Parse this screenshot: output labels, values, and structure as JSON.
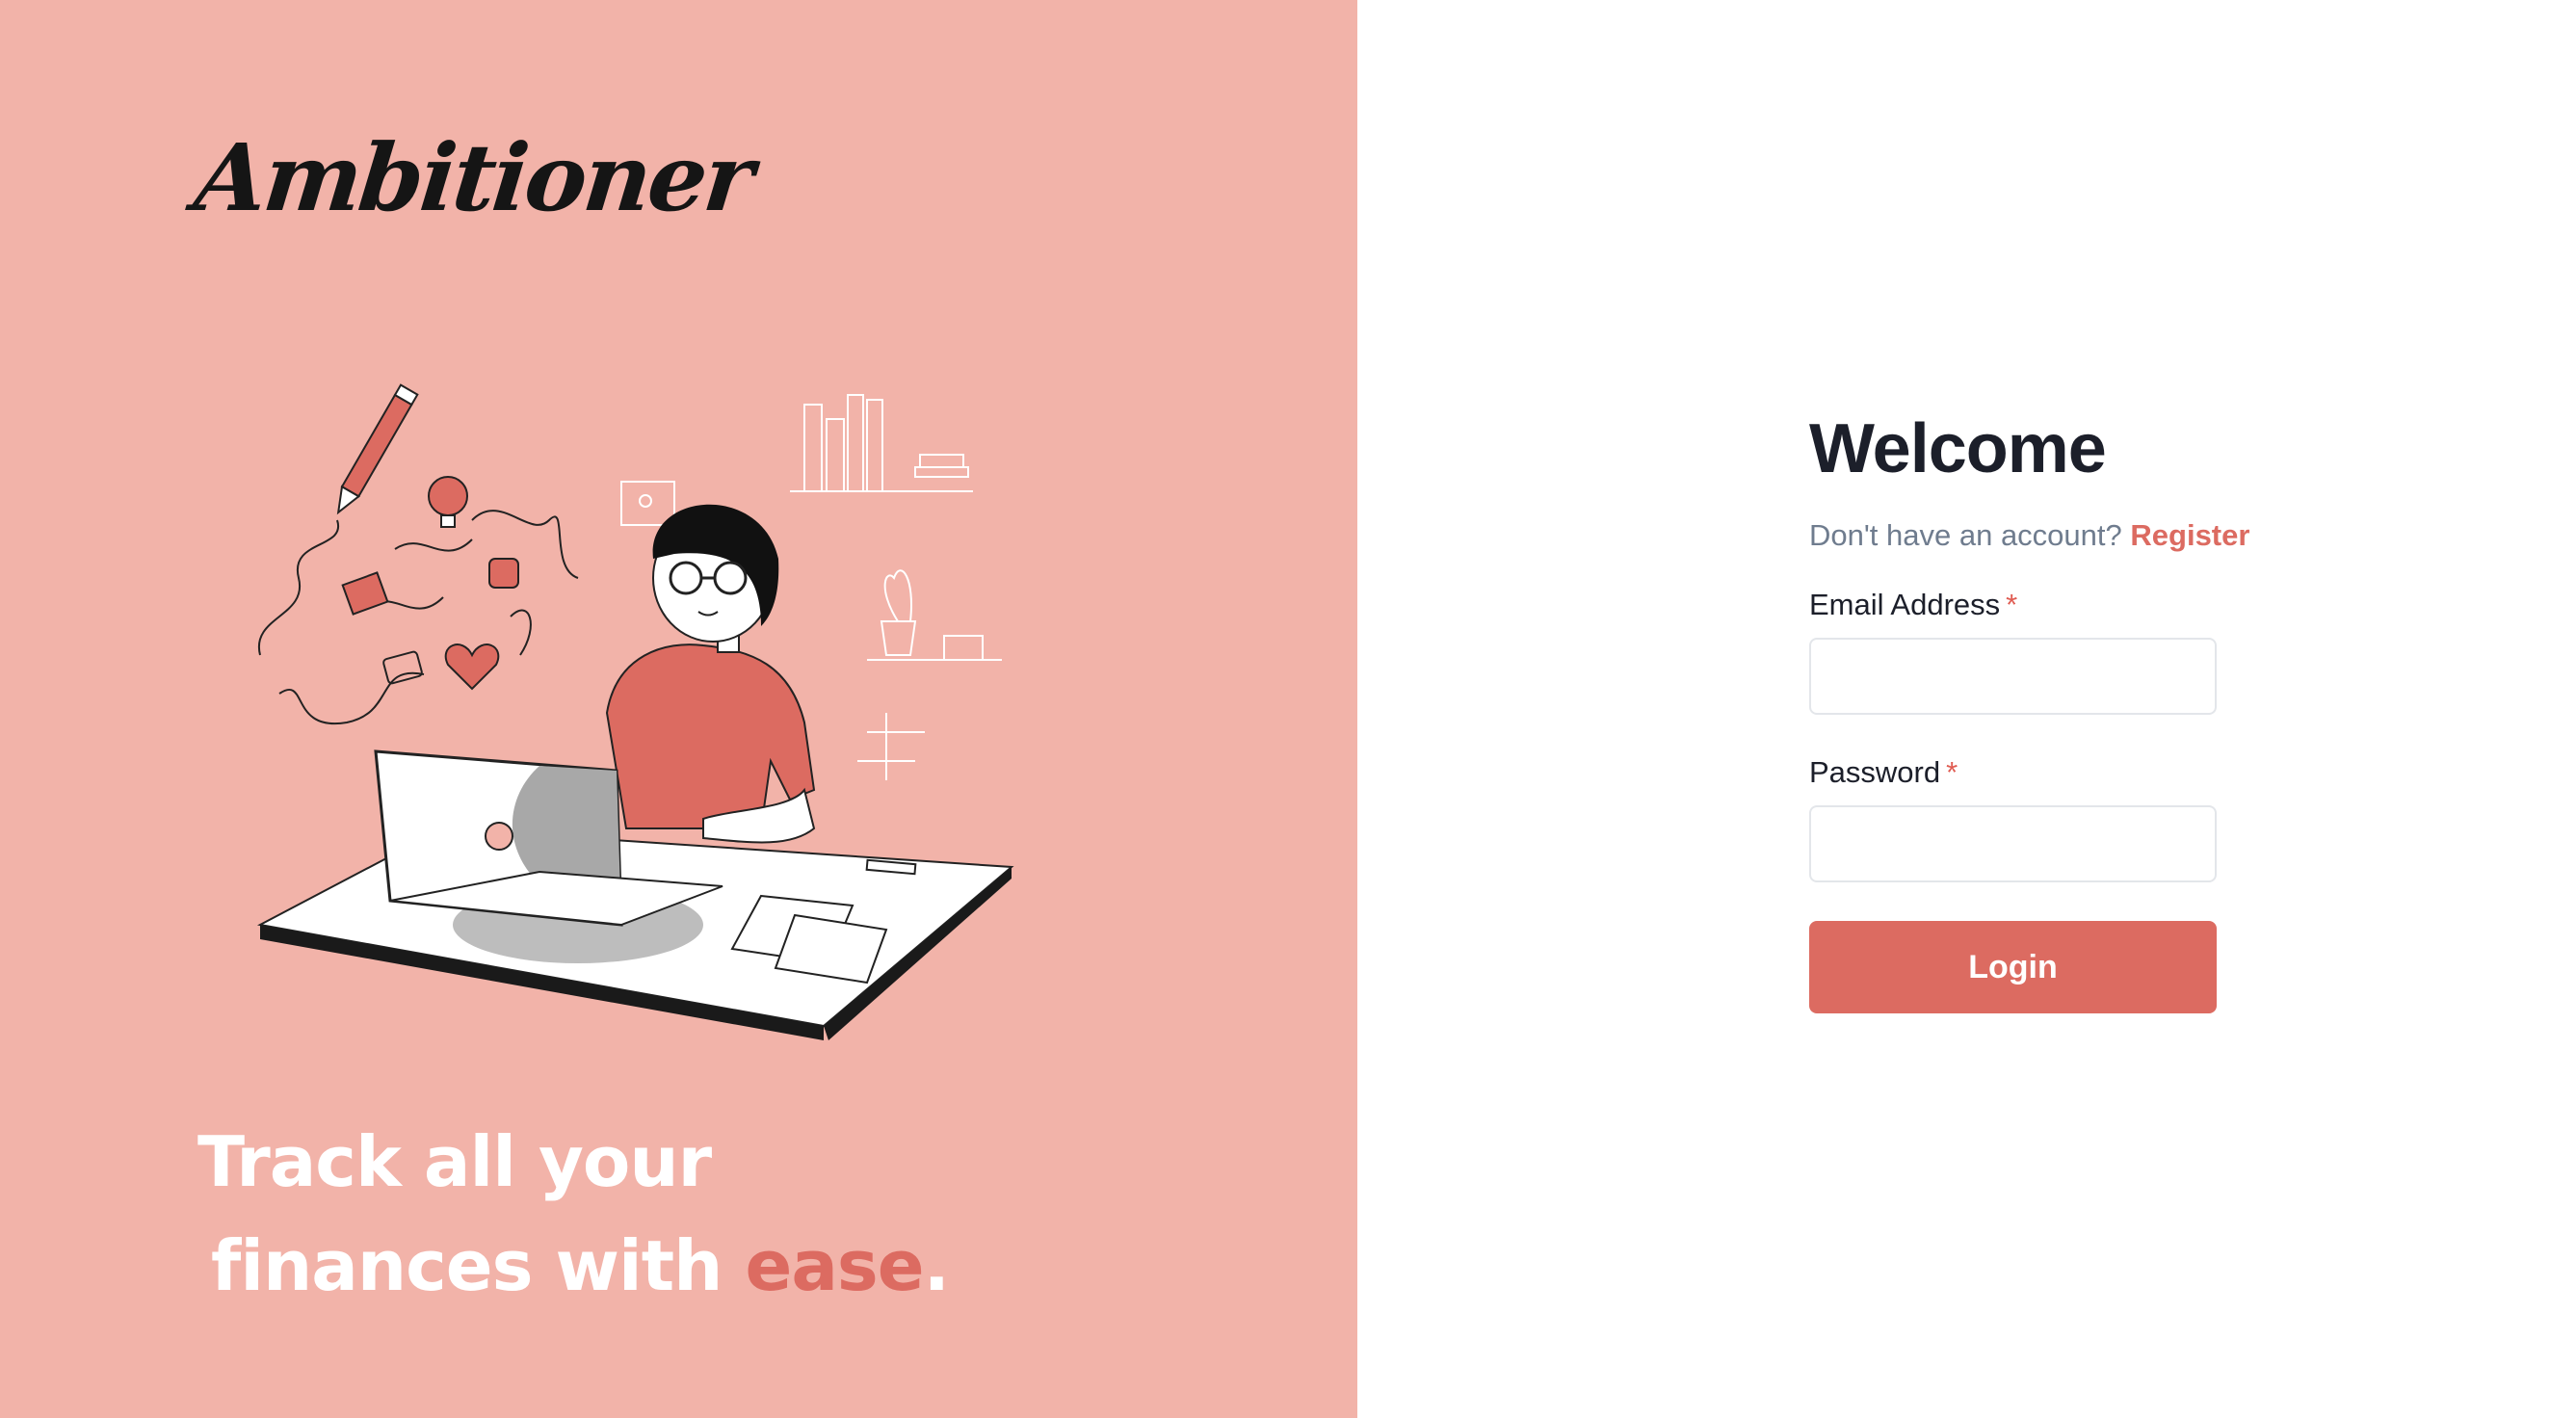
{
  "brand": {
    "logo_text": "Ambitioner"
  },
  "hero": {
    "tagline_line1": "Track all your",
    "tagline_line2_prefix": "finances with ",
    "tagline_accent": "ease",
    "tagline_suffix": "."
  },
  "login": {
    "title": "Welcome",
    "no_account_text": "Don't have an account?",
    "register_link": "Register",
    "email_label": "Email Address",
    "email_value": "",
    "password_label": "Password",
    "password_value": "",
    "required_mark": "*",
    "submit_label": "Login"
  },
  "colors": {
    "left_panel_bg": "#f2b3a9",
    "accent": "#dc6b61",
    "heading": "#1c1f2a",
    "muted_text": "#6f7c8e"
  },
  "icons": {
    "hero_illustration": "person-working-on-laptop-illustration"
  }
}
